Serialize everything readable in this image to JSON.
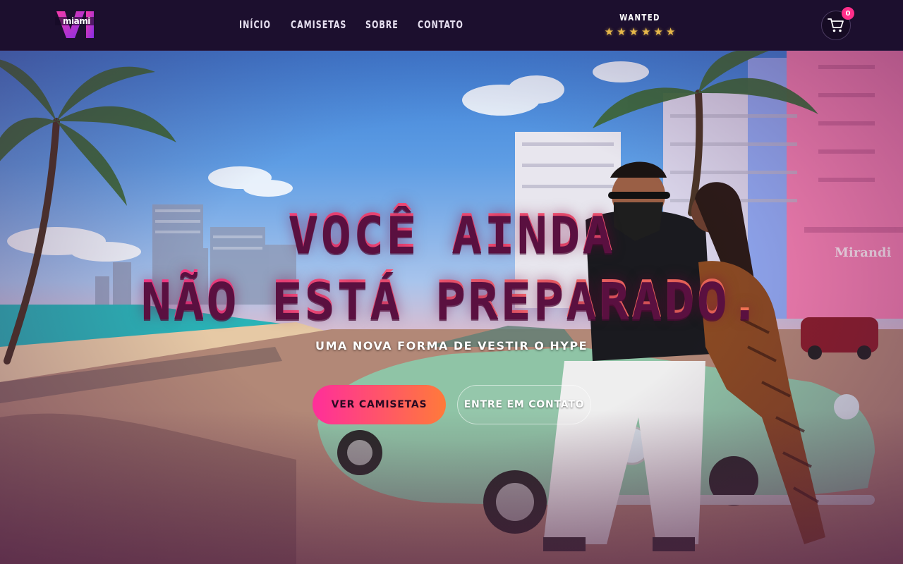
{
  "brand": {
    "logo_text": "miami"
  },
  "nav": {
    "items": [
      "INÍCIO",
      "CAMISETAS",
      "SOBRE",
      "CONTATO"
    ]
  },
  "wanted": {
    "label": "WANTED",
    "stars": 6
  },
  "cart": {
    "count": "0"
  },
  "hero": {
    "title_line1": "VOCÊ AINDA",
    "title_line2": "NÃO ESTÁ PREPARADO.",
    "subtitle": "UMA NOVA FORMA DE VESTIR O HYPE",
    "primary_button": "VER CAMISETAS",
    "secondary_button": "ENTRE EM CONTATO"
  },
  "colors": {
    "header_bg": "#1c0f2e",
    "accent_pink": "#ff2e9a",
    "accent_orange": "#ff7a3a",
    "star_gold": "#e6b84a"
  }
}
